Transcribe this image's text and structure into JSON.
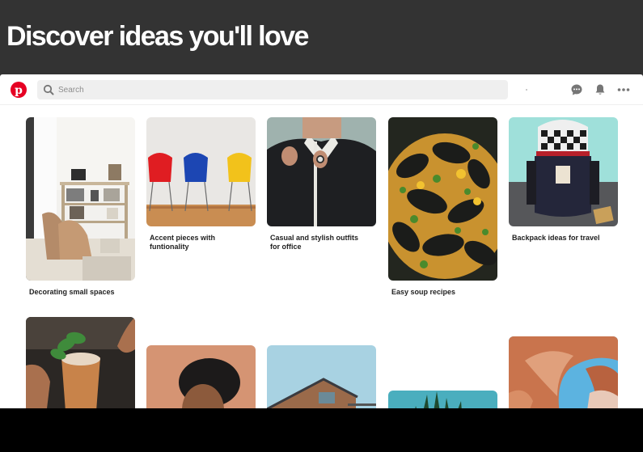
{
  "hero": {
    "title": "Discover ideas you'll love"
  },
  "app": {
    "logo_letter": "p",
    "search": {
      "placeholder": "Search",
      "value": ""
    },
    "icons": [
      "pinterest-logo",
      "search-icon",
      "messages-icon",
      "notifications-icon",
      "more-icon"
    ]
  },
  "pins": [
    {
      "title": "Decorating small spaces"
    },
    {
      "title": "Accent pieces with\nfuntionality"
    },
    {
      "title": "Casual and stylish outfits\nfor office"
    },
    {
      "title": "Easy soup recipes"
    },
    {
      "title": "Backpack ideas for travel"
    },
    {
      "title": ""
    },
    {
      "title": ""
    },
    {
      "title": ""
    },
    {
      "title": ""
    },
    {
      "title": ""
    }
  ],
  "colors": {
    "brand": "#e60023",
    "hero_bg": "#333333",
    "card_bg": "#ffffff"
  }
}
